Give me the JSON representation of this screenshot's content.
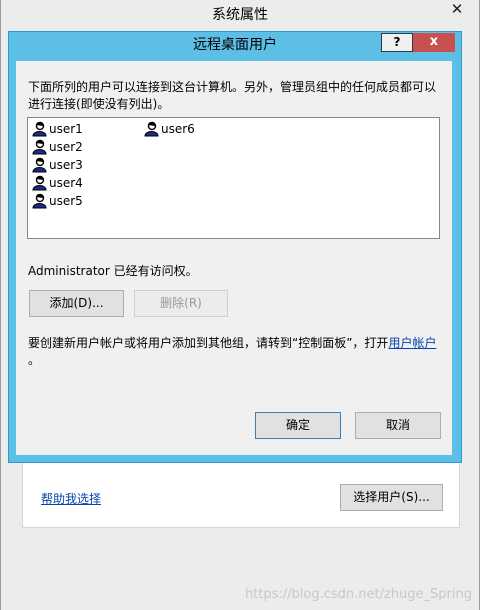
{
  "background_window": {
    "title": "系统属性",
    "close_glyph": "✕",
    "help_link": "帮助我选择",
    "select_users_button": "选择用户(S)..."
  },
  "dialog": {
    "title": "远程桌面用户",
    "help_glyph": "?",
    "close_glyph": "x",
    "intro_text": "下面所列的用户可以连接到这台计算机。另外，管理员组中的任何成员都可以进行连接(即使没有列出)。",
    "users": [
      "user1",
      "user2",
      "user3",
      "user4",
      "user5",
      "user6"
    ],
    "admin_note": "Administrator 已经有访问权。",
    "add_button": "添加(D)...",
    "remove_button": "删除(R)",
    "hint_prefix": "要创建新用户帐户或将用户添加到其他组，请转到“控制面板”，打开",
    "hint_link": "用户帐户",
    "hint_suffix": "。",
    "ok_button": "确定",
    "cancel_button": "取消"
  },
  "watermark": "https://blog.csdn.net/zhuge_Spring"
}
